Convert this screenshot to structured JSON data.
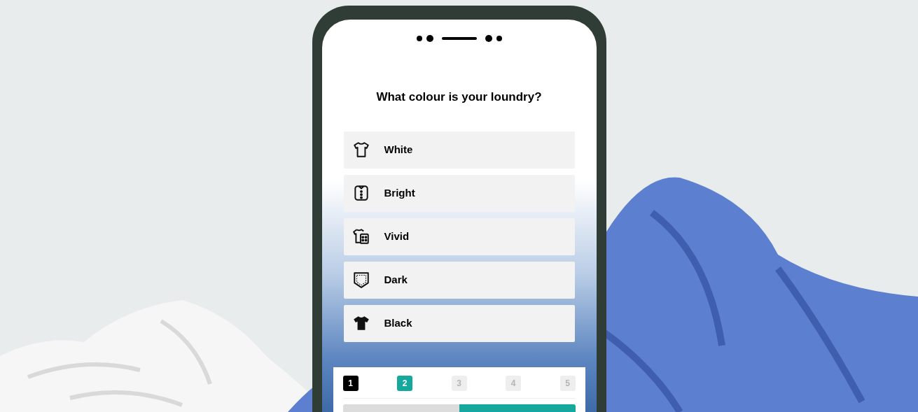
{
  "question": "What colour is your loundry?",
  "options": [
    {
      "label": "White"
    },
    {
      "label": "Bright"
    },
    {
      "label": "Vivid"
    },
    {
      "label": "Dark"
    },
    {
      "label": "Black"
    }
  ],
  "steps": [
    {
      "label": "1",
      "completed": true,
      "selected": false
    },
    {
      "label": "2",
      "completed": false,
      "selected": true
    },
    {
      "label": "3",
      "completed": false,
      "selected": false
    },
    {
      "label": "4",
      "completed": false,
      "selected": false
    },
    {
      "label": "5",
      "completed": false,
      "selected": false
    }
  ]
}
